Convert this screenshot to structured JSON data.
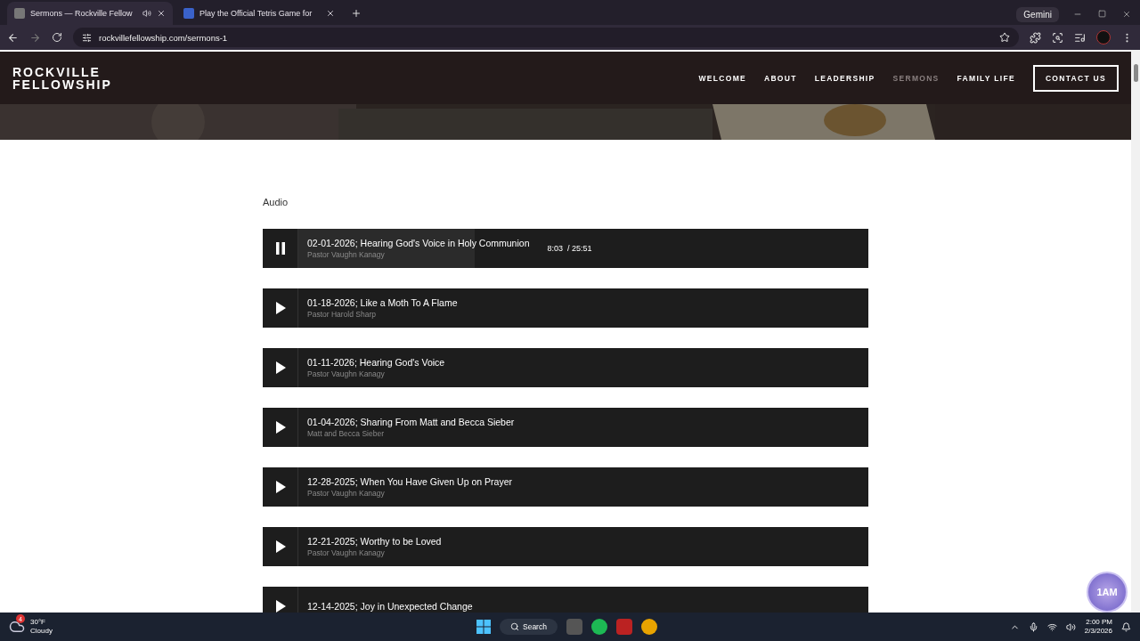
{
  "browser": {
    "tabs": [
      {
        "title": "Sermons — Rockville Fellow",
        "selected": true,
        "audio": true
      },
      {
        "title": "Play the Official Tetris Game for",
        "selected": false,
        "audio": false
      }
    ],
    "gemini": "Gemini",
    "url": "rockvillefellowship.com/sermons-1"
  },
  "site": {
    "logo_line_1": "ROCKVILLE",
    "logo_line_2": "FELLOWSHIP",
    "nav": [
      {
        "label": "WELCOME",
        "selected": false
      },
      {
        "label": "ABOUT",
        "selected": false
      },
      {
        "label": "LEADERSHIP",
        "selected": false
      },
      {
        "label": "SERMONS",
        "selected": true
      },
      {
        "label": "FAMILY LIFE",
        "selected": false
      }
    ],
    "contact": "CONTACT US"
  },
  "section_title": "Audio",
  "tracks": [
    {
      "title": "02-01-2026; Hearing God's Voice in Holy Communion",
      "speaker": "Pastor Vaughn Kanagy",
      "playing": true,
      "level": 0.31,
      "time": "8:03  / 25:51"
    },
    {
      "title": "01-18-2026; Like a Moth To A Flame",
      "speaker": "Pastor Harold Sharp",
      "playing": false
    },
    {
      "title": "01-11-2026; Hearing God's Voice",
      "speaker": "Pastor Vaughn Kanagy",
      "playing": false
    },
    {
      "title": "01-04-2026; Sharing From Matt and Becca Sieber",
      "speaker": "Matt and Becca Sieber",
      "playing": false
    },
    {
      "title": "12-28-2025; When You Have Given Up on Prayer",
      "speaker": "Pastor Vaughn Kanagy",
      "playing": false
    },
    {
      "title": "12-21-2025; Worthy to be Loved",
      "speaker": "Pastor Vaughn Kanagy",
      "playing": false
    },
    {
      "title": "12-14-2025; Joy in Unexpected Change",
      "playing": false
    }
  ],
  "floating_badge": "1AM",
  "taskbar": {
    "weather_badge": "4",
    "temperature": "30°F",
    "condition": "Cloudy",
    "search": "Search",
    "time": "2:00 PM",
    "date": "2/3/2026"
  }
}
